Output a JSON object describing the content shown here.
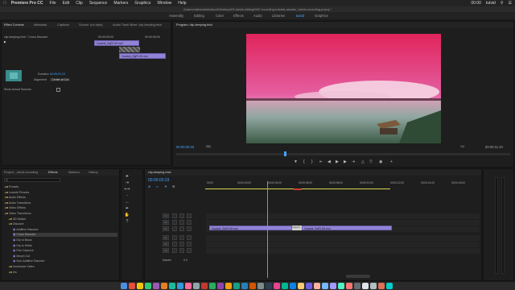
{
  "menubar": {
    "app": "Premiere Pro CC",
    "items": [
      "File",
      "Edit",
      "Clip",
      "Sequence",
      "Markers",
      "Graphics",
      "Window",
      "Help"
    ],
    "clock": "00:00",
    "user": "tutvid"
  },
  "title_path": "/Users/nathanieldodson/Desktop/03-tutvid-editing/002 recording-tutorial-assets/_tutvid-recording.prproj *",
  "workspaces": {
    "tabs": [
      "Assembly",
      "Editing",
      "Color",
      "Effects",
      "Audio",
      "Libraries",
      "tutvid",
      "Graphics"
    ],
    "active": "tutvid"
  },
  "effect_controls": {
    "tabs": [
      "Effect Controls",
      "Metadata",
      "Captions",
      "Source: (no clips)",
      "Audio Track Mixer: clip-keeping-trick"
    ],
    "clip_header": "clip-keeping-trick * Cross Dissolve",
    "mini_times": [
      "00:00:05:00",
      "00:00:06:00"
    ],
    "mini_clip_a": "Vocabal_ZigFit 6H.mov",
    "mini_clip_b": "Vocabal_ZigFit 6H.mov",
    "duration_label": "Duration",
    "duration_value": "00:00:01:13",
    "alignment_label": "Alignment",
    "alignment_value": "Center at Cut",
    "show_sources_label": "Show Actual Sources",
    "footer_time": "00:00:03:23"
  },
  "program_monitor": {
    "title": "Program: clip-keeping-trick",
    "timecode": "00:00:03:23",
    "fit": "Fit",
    "ratio": "1/4",
    "duration": "00:00:11:10"
  },
  "project_panel": {
    "tabs": [
      "Project: _tutvid-recording",
      "Effects",
      "Markers",
      "History"
    ],
    "active_tab": "Effects",
    "tree": [
      {
        "label": "Presets",
        "indent": 0,
        "kind": "folder"
      },
      {
        "label": "Lumetri Presets",
        "indent": 0,
        "kind": "folder"
      },
      {
        "label": "Audio Effects",
        "indent": 0,
        "kind": "folder"
      },
      {
        "label": "Audio Transitions",
        "indent": 0,
        "kind": "folder"
      },
      {
        "label": "Video Effects",
        "indent": 0,
        "kind": "folder"
      },
      {
        "label": "Video Transitions",
        "indent": 0,
        "kind": "folder"
      },
      {
        "label": "3D Motion",
        "indent": 1,
        "kind": "folder"
      },
      {
        "label": "Dissolve",
        "indent": 1,
        "kind": "folder"
      },
      {
        "label": "Additive Dissolve",
        "indent": 2,
        "kind": "item"
      },
      {
        "label": "Cross Dissolve",
        "indent": 2,
        "kind": "item",
        "selected": true
      },
      {
        "label": "Dip to Black",
        "indent": 2,
        "kind": "item"
      },
      {
        "label": "Dip to White",
        "indent": 2,
        "kind": "item"
      },
      {
        "label": "Film Dissolve",
        "indent": 2,
        "kind": "item"
      },
      {
        "label": "Morph Cut",
        "indent": 2,
        "kind": "item"
      },
      {
        "label": "Non-Additive Dissolve",
        "indent": 2,
        "kind": "item"
      },
      {
        "label": "Immersive Video",
        "indent": 1,
        "kind": "folder"
      },
      {
        "label": "Iris",
        "indent": 1,
        "kind": "folder"
      }
    ]
  },
  "timeline": {
    "tab": "clip-keeping-trick",
    "timecode": "00:00:03:23",
    "ruler": [
      "00:00",
      "00:00:02:00",
      "00:00:04:00",
      "00:00:06:00",
      "00:00:08:00",
      "00:00:10:00",
      "00:00:12:00",
      "00:00:14:00",
      "00:00:16:00"
    ],
    "video_tracks": [
      "V3",
      "V2",
      "V1"
    ],
    "audio_tracks": [
      "A1",
      "A2",
      "A3"
    ],
    "master_label": "Master",
    "master_value": "0.0",
    "clip_a": "Vocabal_ZigFit 6H.mov",
    "transition": "Cross D",
    "clip_b": "Vocabal_ZigFit 6H.mov"
  },
  "colors": {
    "accent": "#4aa3ff",
    "clip": "#9183d6",
    "playhead": "#4aa3ff"
  }
}
